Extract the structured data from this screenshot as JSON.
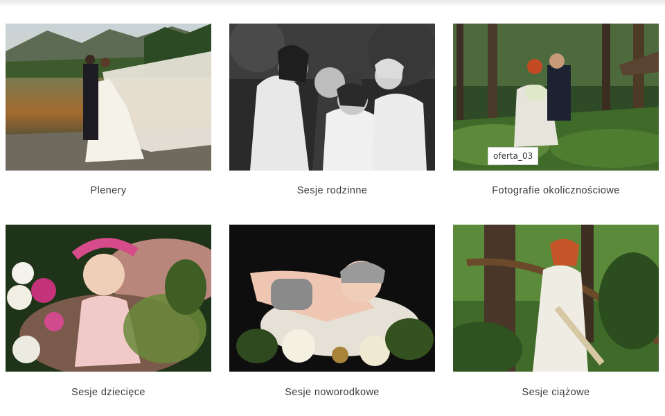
{
  "offers": [
    {
      "title": "Plenery",
      "image": "wedding-couple-lake-mountains"
    },
    {
      "title": "Sesje rodzinne",
      "image": "family-black-white-portrait"
    },
    {
      "title": "Fotografie okolicznościowe",
      "image": "wedding-couple-forest"
    },
    {
      "title": "Sesje dziecięce",
      "image": "baby-with-flower-crown"
    },
    {
      "title": "Sesje noworodkowe",
      "image": "newborn-in-basket"
    },
    {
      "title": "Sesje ciążowe",
      "image": "pregnant-woman-forest"
    }
  ],
  "tooltip": {
    "text": "oferta_03"
  }
}
